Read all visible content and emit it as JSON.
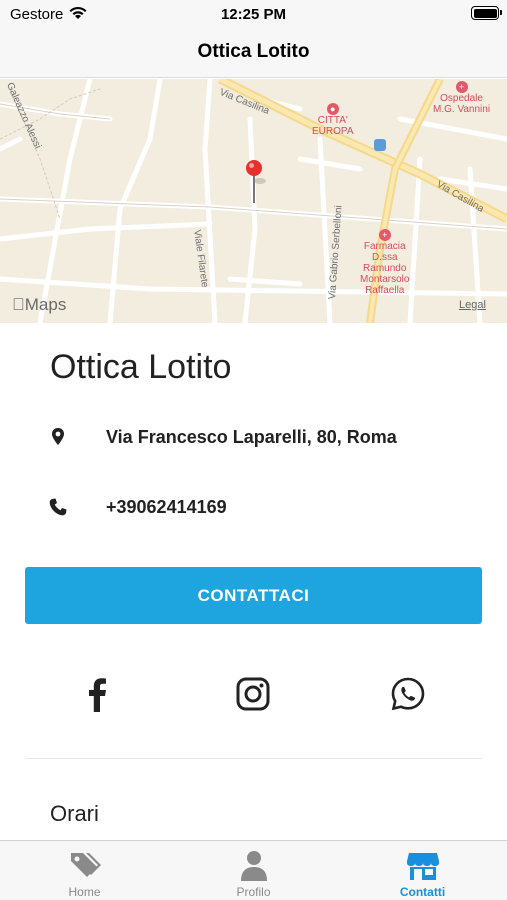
{
  "status_bar": {
    "carrier": "Gestore",
    "time": "12:25 PM"
  },
  "nav": {
    "title": "Ottica Lotito"
  },
  "map": {
    "streets": [
      "Via Casilina",
      "Via Casilina",
      "Viale Filarete",
      "Via Gabrio Serbelloni",
      "Galeazzo Alessi"
    ],
    "poi": [
      {
        "line1": "CITTA'",
        "line2": "EUROPA"
      },
      {
        "line1": "Ospedale",
        "line2": "M.G. Vannini"
      },
      {
        "line1": "Farmacia",
        "line2": "D.ssa",
        "line3": "Ramundo",
        "line4": "Montarsolo",
        "line5": "Raffaella"
      }
    ],
    "logo": "Maps",
    "legal": "Legal"
  },
  "store": {
    "name": "Ottica Lotito",
    "address": "Via Francesco Laparelli, 80, Roma",
    "phone": "+39062414169"
  },
  "contact_button": {
    "label": "CONTATTACI"
  },
  "social": [
    "facebook",
    "instagram",
    "whatsapp"
  ],
  "section": {
    "title": "Orari"
  },
  "tabs": [
    {
      "label": "Home",
      "icon": "tags-icon",
      "active": false
    },
    {
      "label": "Profilo",
      "icon": "person-icon",
      "active": false
    },
    {
      "label": "Contatti",
      "icon": "store-icon",
      "active": true
    }
  ],
  "colors": {
    "accent": "#1ea5e0",
    "active_tab": "#1a8fe0",
    "poi": "#d84c5b"
  }
}
